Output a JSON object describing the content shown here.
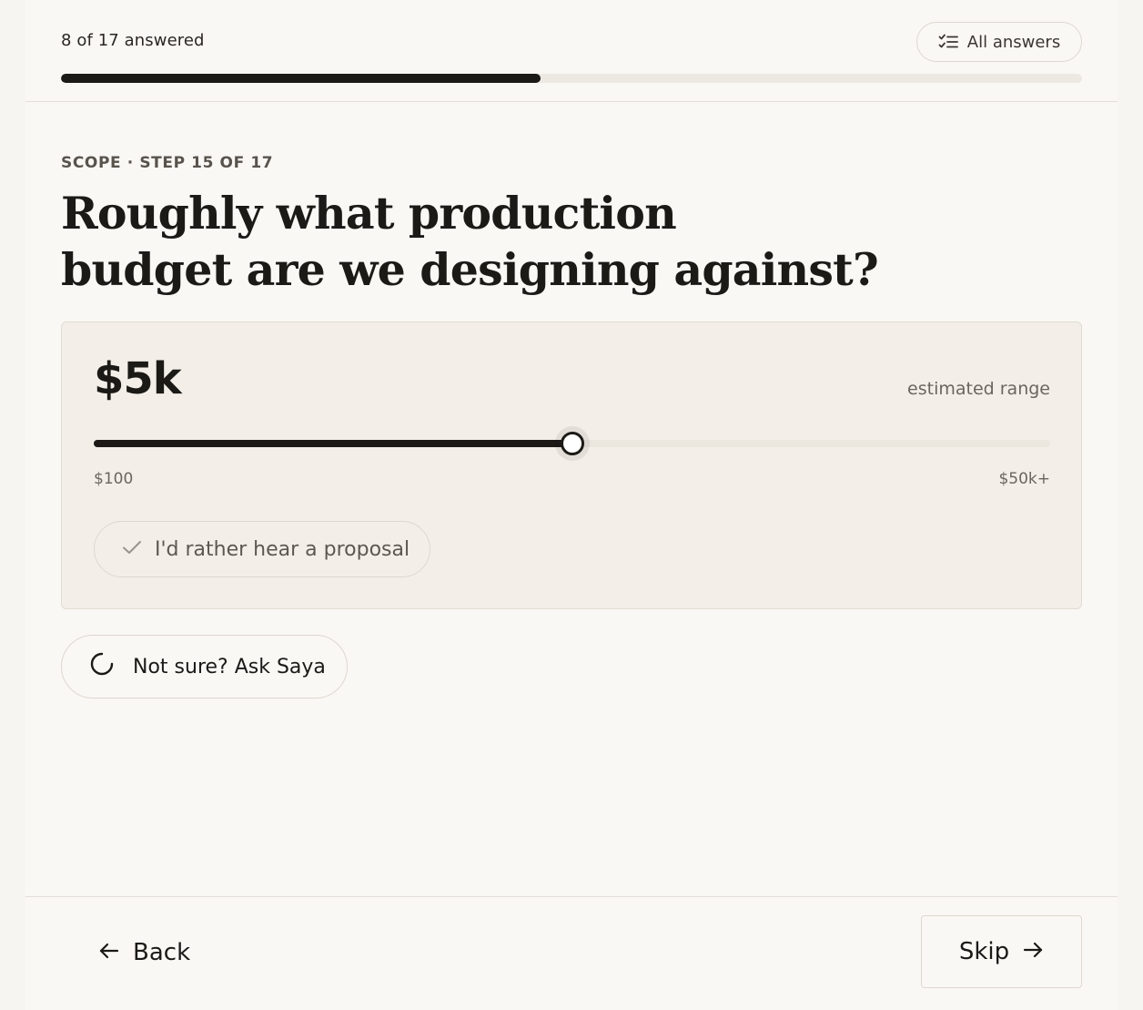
{
  "header": {
    "progress_text": "8 of 17 answered",
    "progress_fraction": 0.47,
    "all_answers_label": "All answers",
    "all_answers_icon": "checklist-icon"
  },
  "question": {
    "eyebrow": "SCOPE · STEP 15 OF 17",
    "line1": "Roughly what production",
    "line2": "budget are we designing against?"
  },
  "budget": {
    "value_label": "$5k",
    "range_note": "estimated range",
    "min_label": "$100",
    "max_label": "$50k+",
    "slider_fraction": 0.5,
    "proposal_option": "I'd rather hear a proposal",
    "proposal_icon": "check-icon"
  },
  "assist": {
    "label": "Not sure? Ask Saya",
    "icon": "spinner-icon"
  },
  "footer": {
    "back_label": "Back",
    "back_icon": "arrow-left-icon",
    "skip_label": "Skip",
    "skip_icon": "arrow-right-icon"
  },
  "colors": {
    "background": "#faf8f5",
    "card": "#f3efe8",
    "ink": "#1c1a17",
    "muted": "#6b655d",
    "border": "#ddd7ce"
  }
}
